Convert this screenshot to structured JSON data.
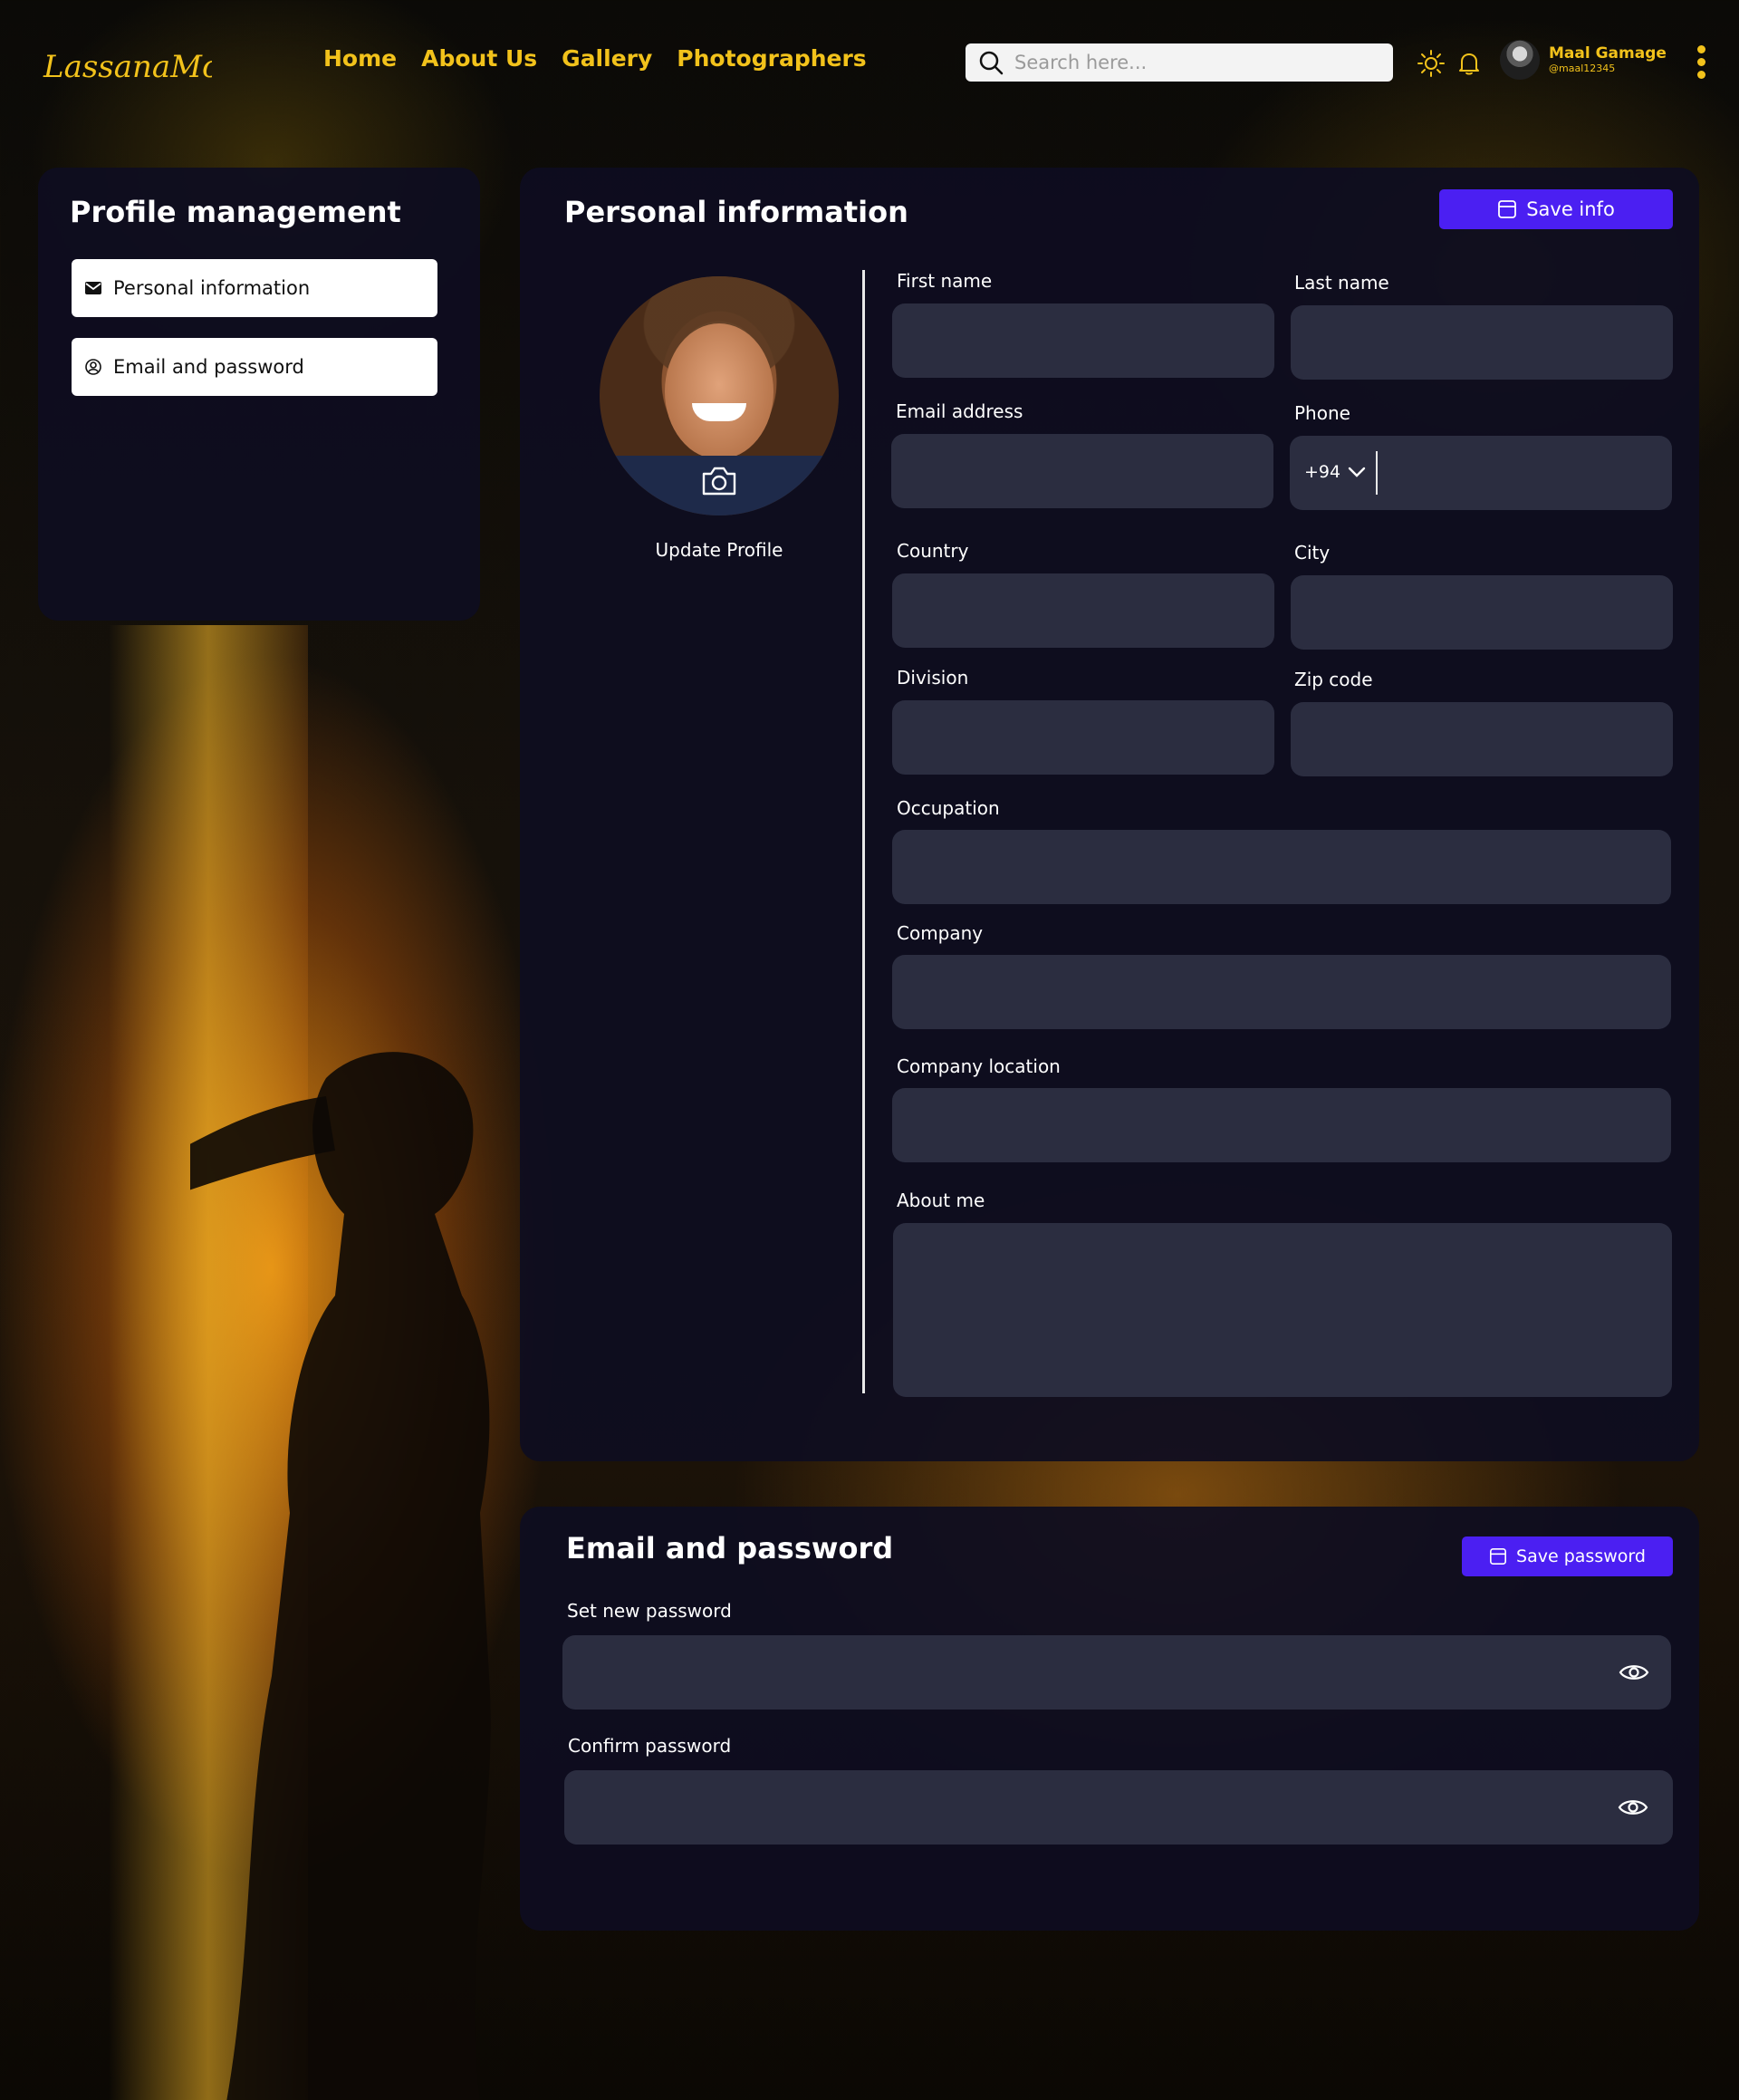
{
  "brand": {
    "logo_text": "LassanaMomentz",
    "accent": "#f2c21b",
    "primary": "#4b1ff2"
  },
  "nav": {
    "links": [
      "Home",
      "About Us",
      "Gallery",
      "Photographers"
    ],
    "search_placeholder": "Search here...",
    "icons": [
      "search-icon",
      "sun-icon",
      "bell-icon",
      "more-vertical-icon"
    ],
    "user": {
      "name": "Maal Gamage",
      "handle": "@maal12345"
    }
  },
  "sidebar": {
    "title": "Profile management",
    "items": [
      {
        "label": "Personal information",
        "icon": "mail-icon"
      },
      {
        "label": "Email and password",
        "icon": "user-circle-icon"
      }
    ]
  },
  "personal_info": {
    "title": "Personal information",
    "save_label": "Save info",
    "update_profile_label": "Update Profile",
    "fields": {
      "first_name": "First name",
      "last_name": "Last name",
      "email": "Email address",
      "phone": "Phone",
      "phone_code": "+94",
      "country": "Country",
      "city": "City",
      "division": "Division",
      "zip": "Zip code",
      "occupation": "Occupation",
      "company": "Company",
      "company_location": "Company location",
      "about": "About me"
    }
  },
  "email_password": {
    "title": "Email and password",
    "save_label": "Save password",
    "new_password": "Set new password",
    "confirm_password": "Confirm password"
  }
}
